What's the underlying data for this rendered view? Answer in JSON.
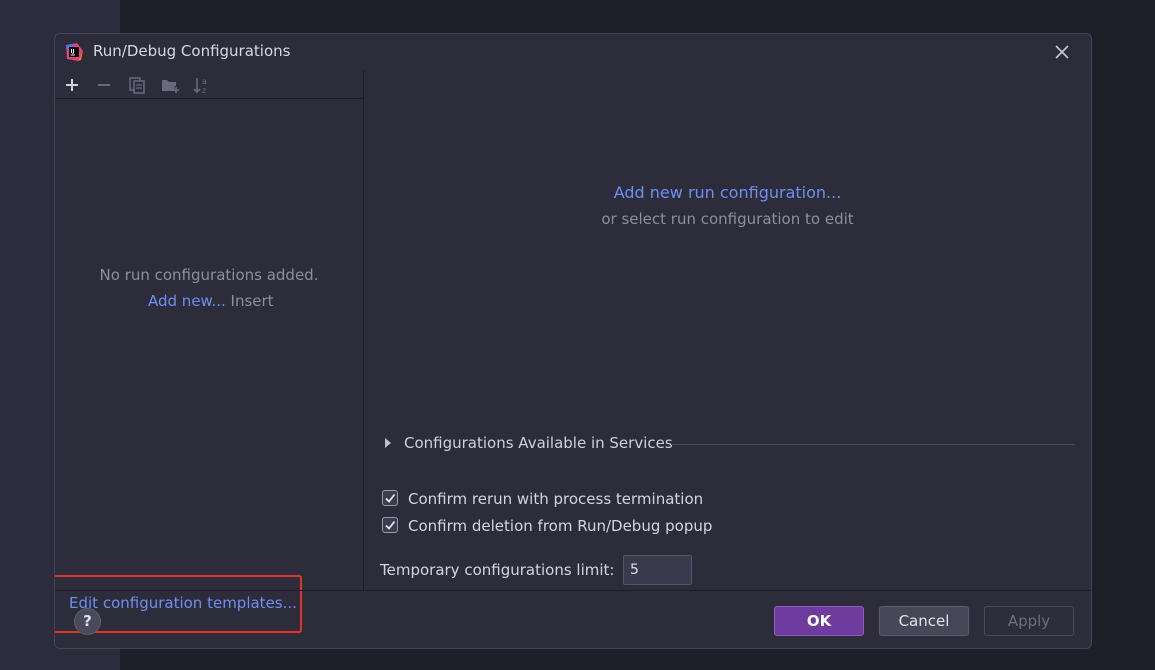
{
  "dialog": {
    "title": "Run/Debug Configurations"
  },
  "left_pane": {
    "empty_message": "No run configurations added.",
    "add_new_link": "Add new...",
    "add_new_shortcut": "Insert",
    "edit_templates_link": "Edit configuration templates..."
  },
  "right_pane": {
    "add_run_link": "Add new run configuration...",
    "or_select": "or select run configuration to edit",
    "services_label": "Configurations Available in Services",
    "confirm_rerun_label": "Confirm rerun with process termination",
    "confirm_rerun_checked": true,
    "confirm_deletion_label": "Confirm deletion from Run/Debug popup",
    "confirm_deletion_checked": true,
    "temp_limit_label": "Temporary configurations limit:",
    "temp_limit_value": "5"
  },
  "footer": {
    "help_label": "?",
    "ok_label": "OK",
    "cancel_label": "Cancel",
    "apply_label": "Apply"
  },
  "icons": {
    "app": "intellij-idea-icon",
    "close": "close-icon",
    "add": "plus-icon",
    "remove": "minus-icon",
    "copy": "copy-icon",
    "folder": "new-folder-icon",
    "sort": "sort-alpha-icon",
    "triangle": "expand-triangle-icon",
    "checkbox": "check-icon"
  },
  "colors": {
    "accent_link": "#6f8ff0",
    "ok_button": "#6f3b9e",
    "highlight_box": "#e0332a",
    "dialog_bg": "#2c2c3b"
  }
}
